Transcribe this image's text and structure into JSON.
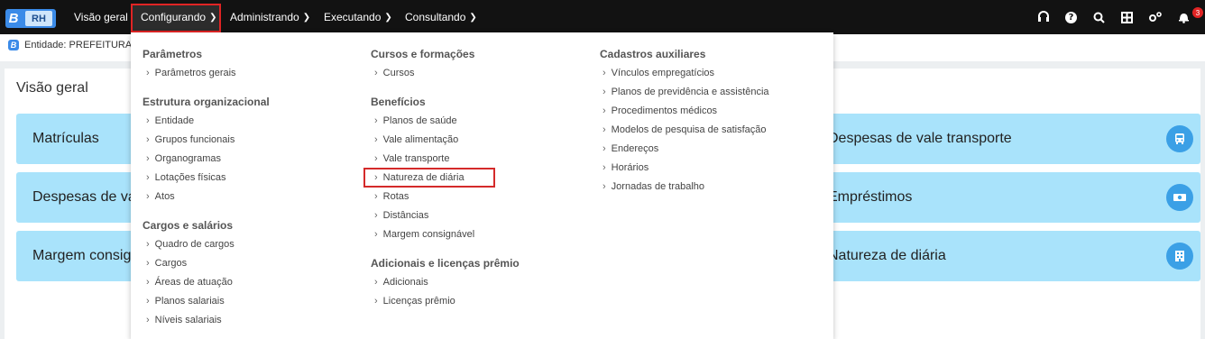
{
  "brand": {
    "logo_letter": "B",
    "product": "RH"
  },
  "nav": [
    {
      "label": "Visão geral",
      "has_menu": false
    },
    {
      "label": "Configurando",
      "has_menu": true,
      "active": true
    },
    {
      "label": "Administrando",
      "has_menu": true
    },
    {
      "label": "Executando",
      "has_menu": true
    },
    {
      "label": "Consultando",
      "has_menu": true
    }
  ],
  "top_icons": [
    "headset-icon",
    "help-icon",
    "search-icon",
    "grid-icon",
    "settings-icon",
    "bell-icon"
  ],
  "notifications": {
    "count": "3"
  },
  "entity": {
    "text": "Entidade: PREFEITURA D"
  },
  "page": {
    "title": "Visão geral"
  },
  "cards_left": [
    "Matrículas",
    "Despesas de val",
    "Margem consig"
  ],
  "cards_right": [
    {
      "label": "Despesas de vale transporte",
      "icon": "bus-icon"
    },
    {
      "label": "Empréstimos",
      "icon": "money-icon"
    },
    {
      "label": "Natureza de diária",
      "icon": "building-icon"
    }
  ],
  "menu": {
    "col1": {
      "sections": [
        {
          "title": "Parâmetros",
          "items": [
            "Parâmetros gerais"
          ]
        },
        {
          "title": "Estrutura organizacional",
          "items": [
            "Entidade",
            "Grupos funcionais",
            "Organogramas",
            "Lotações físicas",
            "Atos"
          ]
        },
        {
          "title": "Cargos e salários",
          "items": [
            "Quadro de cargos",
            "Cargos",
            "Áreas de atuação",
            "Planos salariais",
            "Níveis salariais"
          ]
        }
      ]
    },
    "col2": {
      "sections": [
        {
          "title": "Cursos e formações",
          "items": [
            "Cursos"
          ]
        },
        {
          "title": "Benefícios",
          "items": [
            "Planos de saúde",
            "Vale alimentação",
            "Vale transporte",
            "Natureza de diária",
            "Rotas",
            "Distâncias",
            "Margem consignável"
          ]
        },
        {
          "title": "Adicionais e licenças prêmio",
          "items": [
            "Adicionais",
            "Licenças prêmio"
          ]
        }
      ]
    },
    "col3": {
      "sections": [
        {
          "title": "Cadastros auxiliares",
          "items": [
            "Vínculos empregatícios",
            "Planos de previdência e assistência",
            "Procedimentos médicos",
            "Modelos de pesquisa de satisfação",
            "Endereços",
            "Horários",
            "Jornadas de trabalho"
          ]
        }
      ]
    }
  }
}
